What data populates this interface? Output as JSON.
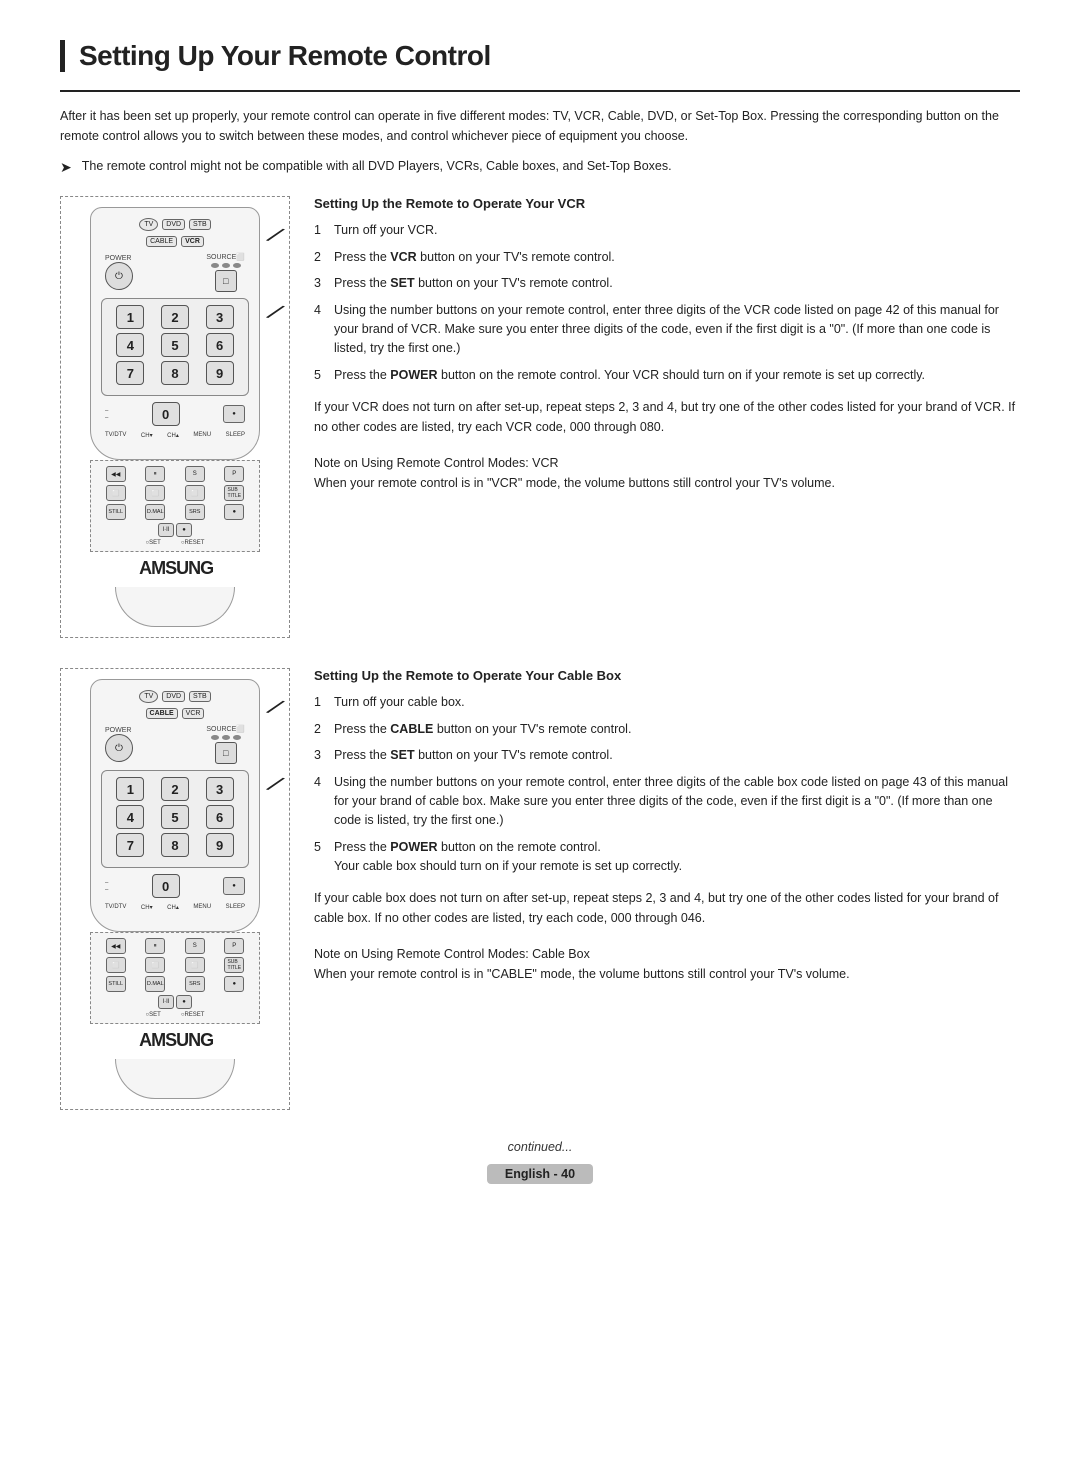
{
  "page": {
    "title": "Setting Up Your Remote Control",
    "intro": "After it has been set up properly, your remote control can operate in five different modes: TV, VCR, Cable, DVD, or Set-Top Box. Pressing the corresponding button on the remote control allows you to switch between these modes, and control whichever piece of equipment you choose.",
    "note": "The remote control might not be compatible with all DVD Players, VCRs, Cable boxes, and Set-Top Boxes.",
    "continued": "continued...",
    "footer_label": "English - 40"
  },
  "vcr_section": {
    "title": "Setting Up the Remote to Operate Your VCR",
    "steps": [
      {
        "num": "1",
        "text": "Turn off your VCR."
      },
      {
        "num": "2",
        "text": "Press the <b>VCR</b> button on your TV's remote control."
      },
      {
        "num": "3",
        "text": "Press the <b>SET</b> button on your TV's remote control."
      },
      {
        "num": "4",
        "text": "Using the number buttons on your remote control, enter three digits of the VCR code listed on page 42 of this manual for your brand of VCR. Make sure you enter three digits of the code, even if the first digit is a \"0\". (If more than one code is listed, try the first one.)"
      },
      {
        "num": "5",
        "text": "Press the <b>POWER</b> button on the remote control. Your VCR should turn on if your remote is set up correctly."
      }
    ],
    "if_not_turn_on": "If your VCR does not turn on after set-up, repeat steps 2, 3 and 4, but try one of the other codes listed for your brand of VCR. If no other codes are listed, try each VCR code, 000 through 080.",
    "note_title": "Note on Using Remote Control Modes: VCR",
    "note_text": "When your remote control is in \"VCR\" mode, the volume buttons still control your TV's volume."
  },
  "cable_section": {
    "title": "Setting Up the Remote to Operate Your Cable Box",
    "steps": [
      {
        "num": "1",
        "text": "Turn off your cable box."
      },
      {
        "num": "2",
        "text": "Press the <b>CABLE</b> button on your TV's remote control."
      },
      {
        "num": "3",
        "text": "Press the <b>SET</b> button on your TV's remote control."
      },
      {
        "num": "4",
        "text": "Using the number buttons on your remote control, enter three digits of the cable box code listed on page 43 of this manual for your brand of cable box. Make sure you enter three digits of the code, even if the first digit is a \"0\". (If more than one code is listed, try the first one.)"
      },
      {
        "num": "5",
        "text": "Press the <b>POWER</b> button on the remote control. Your cable box should turn on if your remote is set up correctly."
      }
    ],
    "if_not_turn_on": "If your cable box does not turn on after set-up, repeat steps 2, 3 and 4, but try one of the other codes listed for your brand of cable box. If no other codes are listed, try each code, 000 through 046.",
    "note_title": "Note on Using Remote Control Modes: Cable Box",
    "note_text": "When your remote control is in \"CABLE\" mode, the volume buttons still control your TV's volume."
  },
  "remote": {
    "mode_buttons": [
      "TV",
      "DVD",
      "STB",
      "CABLE",
      "VCR"
    ],
    "numbers": [
      [
        "1",
        "2",
        "3"
      ],
      [
        "4",
        "5",
        "6"
      ],
      [
        "7",
        "8",
        "9"
      ]
    ],
    "zero": "0"
  }
}
